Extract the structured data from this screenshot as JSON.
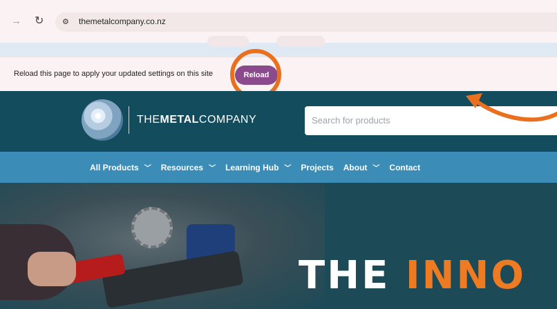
{
  "browser": {
    "forward_icon": "arrow-right-icon",
    "reload_icon": "refresh-icon",
    "site_info_icon": "tune-icon",
    "url": "themetalcompany.co.nz"
  },
  "infobar": {
    "message": "Reload this page to apply your updated settings on this site",
    "reload_label": "Reload",
    "reload_color": "#8a4a8c"
  },
  "header": {
    "logo_prefix": "THE",
    "logo_bold": "METAL",
    "logo_suffix": "COMPANY",
    "search_placeholder": "Search for products"
  },
  "menu": {
    "items": [
      {
        "label": "All Products",
        "has_dropdown": true
      },
      {
        "label": "Resources",
        "has_dropdown": true
      },
      {
        "label": "Learning Hub",
        "has_dropdown": true
      },
      {
        "label": "Projects",
        "has_dropdown": false
      },
      {
        "label": "About",
        "has_dropdown": true
      },
      {
        "label": "Contact",
        "has_dropdown": false
      }
    ]
  },
  "hero": {
    "title_white": "THE",
    "title_orange": "INNO"
  },
  "annotation": {
    "highlight_color": "#e8701f"
  }
}
